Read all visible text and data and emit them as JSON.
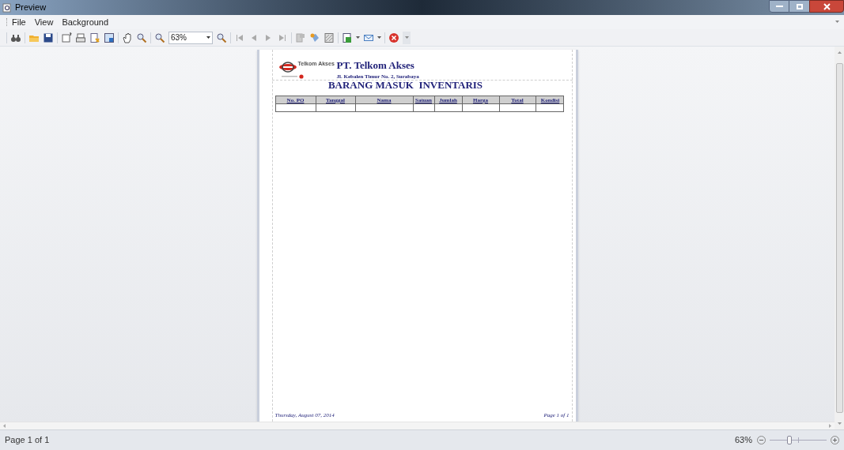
{
  "window": {
    "title": "Preview"
  },
  "menu": [
    "File",
    "View",
    "Background"
  ],
  "toolbar": {
    "zoom_value": "63%"
  },
  "report": {
    "logo_text": "Telkom Akses",
    "company": "PT. Telkom Akses",
    "address": "Jl. Kebalen Timur No. 2, Surabaya",
    "title": "BARANG MASUK  INVENTARIS",
    "columns": [
      "No. PO",
      "Tanggal",
      "Nama",
      "Satuan",
      "Jumlah",
      "Harga",
      "Total",
      "Kondisi"
    ],
    "footer_date": "Thursday, August 07, 2014",
    "footer_page": "Page 1 of 1"
  },
  "status_bar": {
    "page": "Page 1 of 1",
    "zoom": "63%",
    "zoom_slider": {
      "level": 0.33
    }
  }
}
